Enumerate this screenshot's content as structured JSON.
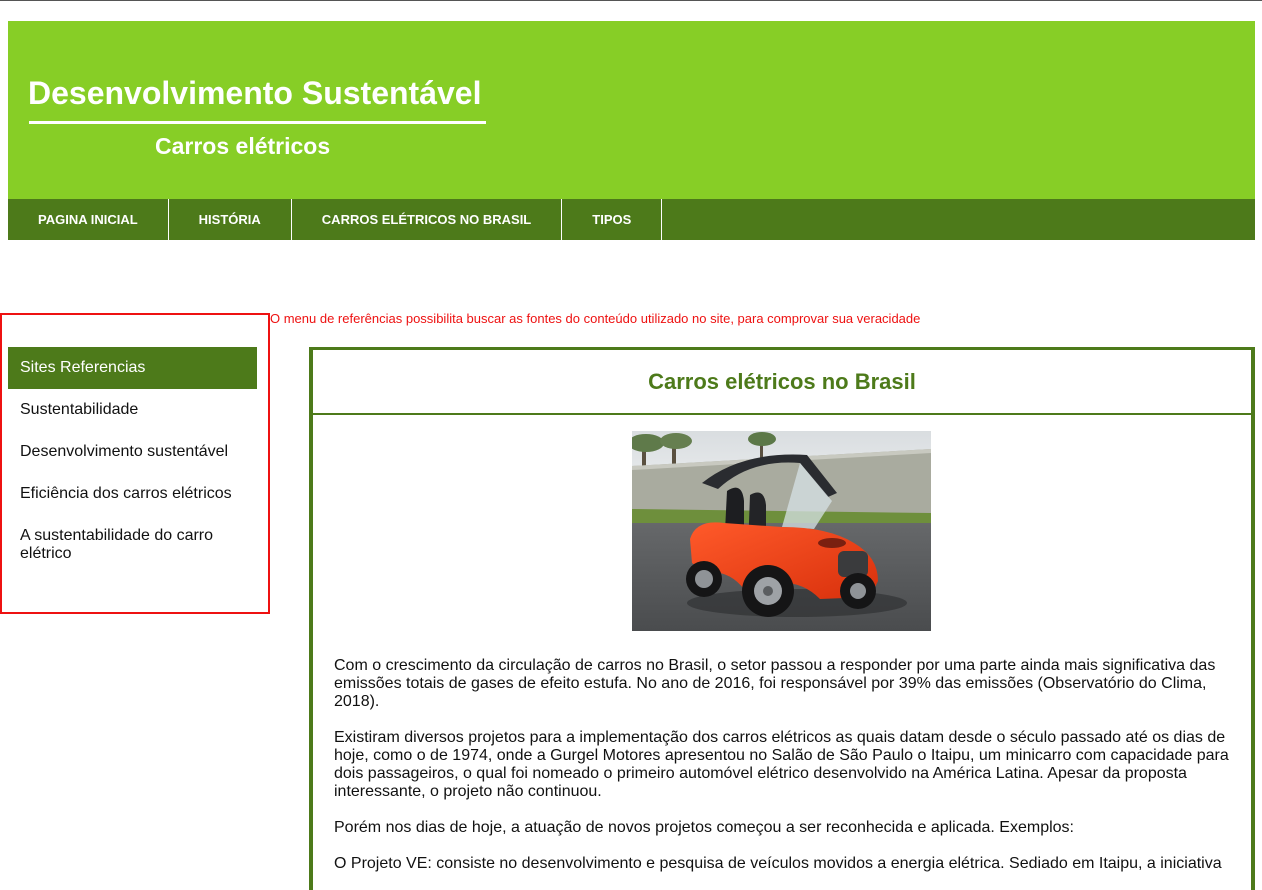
{
  "header": {
    "title": "Desenvolvimento Sustentável",
    "subtitle": "Carros elétricos",
    "background": "#87ce26"
  },
  "nav": {
    "items": [
      {
        "label": "PAGINA INICIAL"
      },
      {
        "label": "HISTÓRIA"
      },
      {
        "label": "CARROS ELÉTRICOS NO BRASIL"
      },
      {
        "label": "TIPOS"
      }
    ],
    "background": "#4d7a1a"
  },
  "note": "O menu de referências possibilita buscar as fontes do conteúdo utilizado no site, para comprovar sua veracidade",
  "sidebar": {
    "items": [
      {
        "label": "Sites Referencias",
        "active": true
      },
      {
        "label": "Sustentabilidade"
      },
      {
        "label": "Desenvolvimento sustentável"
      },
      {
        "label": "Eficiência dos carros elétricos"
      },
      {
        "label": "A sustentabilidade do carro elétrico"
      }
    ],
    "highlight_color": "#ee1111"
  },
  "main": {
    "title": "Carros elétricos no Brasil",
    "image": "electric-car-photo",
    "paragraphs": [
      "Com o crescimento da circulação de carros no Brasil, o setor passou a responder por uma parte ainda mais significativa das emissões totais de gases de efeito estufa. No ano de 2016, foi responsável por 39% das emissões (Observatório do Clima, 2018).",
      "Existiram diversos projetos para a implementação dos carros elétricos as quais datam desde o século passado até os dias de hoje, como o de 1974, onde a Gurgel Motores apresentou no Salão de São Paulo o Itaipu, um minicarro com capacidade para dois passageiros, o qual foi nomeado o primeiro automóvel elétrico desenvolvido na América Latina. Apesar da proposta interessante, o projeto não continuou.",
      "Porém nos dias de hoje, a atuação de novos projetos começou a ser reconhecida e aplicada. Exemplos:",
      "O Projeto VE: consiste no desenvolvimento e pesquisa de veículos movidos a energia elétrica. Sediado em Itaipu, a iniciativa"
    ]
  }
}
